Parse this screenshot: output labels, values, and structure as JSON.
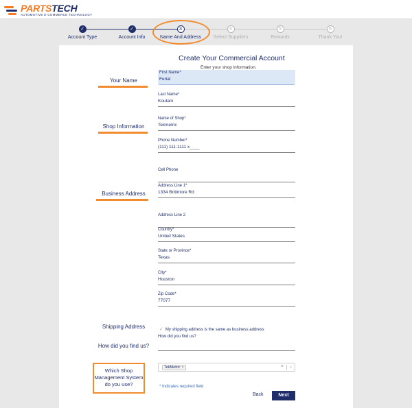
{
  "brand": {
    "logo_first": "PARTS",
    "logo_second": "TECH",
    "tagline": "AUTOMOTIVE E-COMMERCE TECHNOLOGY"
  },
  "steps": [
    {
      "number": "",
      "label": "Account Type",
      "state": "done"
    },
    {
      "number": "",
      "label": "Account Info",
      "state": "done"
    },
    {
      "number": "3",
      "label": "Name And Address",
      "state": "current"
    },
    {
      "number": "4",
      "label": "Select Suppliers",
      "state": "future"
    },
    {
      "number": "5",
      "label": "Rewards",
      "state": "future"
    },
    {
      "number": "6",
      "label": "Thank You!",
      "state": "future"
    }
  ],
  "form": {
    "title": "Create Your Commercial Account",
    "subtitle": "Enter your shop information.",
    "fields": {
      "first_name": {
        "label": "First Name*",
        "value": "Ferial"
      },
      "last_name": {
        "label": "Last Name*",
        "value": "Koutani"
      },
      "shop_name": {
        "label": "Name of Shop*",
        "value": "Tekmetric"
      },
      "phone": {
        "label": "Phone Number*",
        "value": "(111) 111-1111 x____"
      },
      "cell_phone": {
        "label": "Cell Phone",
        "value": ""
      },
      "address1": {
        "label": "Address Line 1*",
        "value": "1334 Brittmore Rd"
      },
      "address2": {
        "label": "Address Line 2",
        "value": ""
      },
      "country": {
        "label": "Country*",
        "value": "United States"
      },
      "state": {
        "label": "State or Province*",
        "value": "Texas"
      },
      "city": {
        "label": "City*",
        "value": "Houston"
      },
      "zip": {
        "label": "Zip Code*",
        "value": "77077"
      },
      "find_us": {
        "label": "How did you find us?",
        "value": ""
      }
    },
    "shipping_same_label": "My shipping address is the same as business address",
    "sms_chip": "TekMetric",
    "required_note": "* Indicates required field",
    "back_label": "Back",
    "next_label": "Next"
  },
  "sections": {
    "your_name": "Your Name",
    "shop_information": "Shop Information",
    "business_address": "Business Address",
    "shipping_address": "Shipping Address",
    "find_us": "How did you find us?",
    "sms": "Which Shop Management System do you use?"
  },
  "colors": {
    "brand_navy": "#1f2e6b",
    "brand_orange": "#f47b20",
    "annotation_orange": "#f28a2e",
    "active_field_bg": "#dde8f7"
  }
}
